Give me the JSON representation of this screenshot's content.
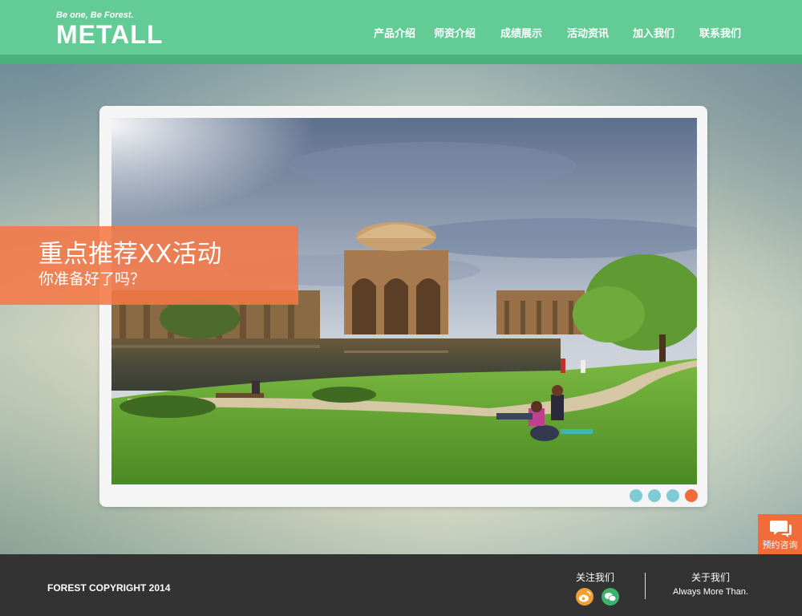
{
  "header": {
    "logo_tagline": "Be one, Be Forest.",
    "logo_name": "METALL",
    "nav": [
      {
        "label": "产品介绍"
      },
      {
        "label": "师资介绍"
      },
      {
        "label": "成绩展示"
      },
      {
        "label": "活动资讯"
      },
      {
        "label": "加入我们"
      },
      {
        "label": "联系我们"
      }
    ]
  },
  "banner": {
    "promo_title": "重点推荐XX活动",
    "promo_subtitle": "你准备好了吗？",
    "slider_dots": [
      {
        "active": false,
        "color": "#7ecbd6"
      },
      {
        "active": false,
        "color": "#7ecbd6"
      },
      {
        "active": false,
        "color": "#7ecbd6"
      },
      {
        "active": true,
        "color": "#f26b3a"
      }
    ],
    "photo_icon": "palace-of-fine-arts-photo"
  },
  "consult_button": {
    "label": "预约咨询",
    "icon": "chat-bubble-icon",
    "color": "#f26b3a"
  },
  "footer": {
    "copyright": "FOREST COPYRIGHT 2014",
    "follow_title": "关注我们",
    "social": [
      {
        "icon": "weibo-icon",
        "color": "#f0a030"
      },
      {
        "icon": "wechat-icon",
        "color": "#3bb36a"
      }
    ],
    "about_title": "关于我们",
    "about_subtitle": "Always More Than."
  },
  "colors": {
    "header_green": "#62cb96",
    "header_strip": "#4db07f",
    "footer_dark": "#333333",
    "accent_orange": "#f26b3a"
  }
}
